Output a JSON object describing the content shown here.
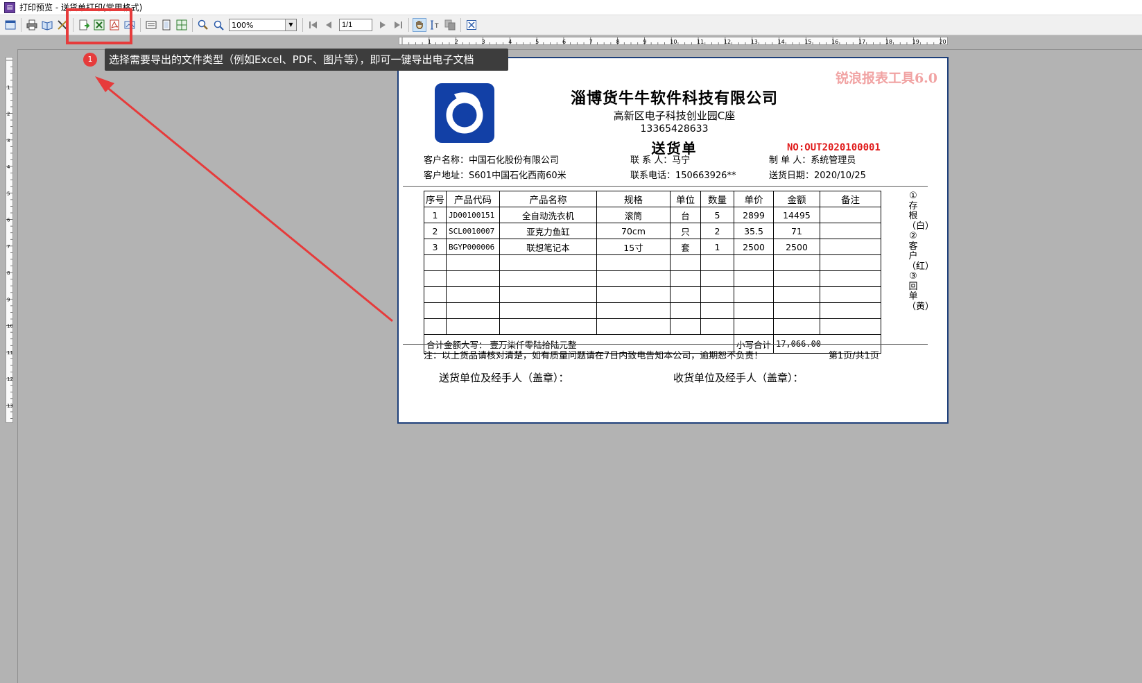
{
  "window": {
    "title": "打印预览 - 送货单打印(常用格式)"
  },
  "toolbar": {
    "zoom_value": "100%",
    "page_value": "1/1"
  },
  "tooltip": {
    "badge": "1",
    "text": "选择需要导出的文件类型（例如Excel、PDF、图片等），即可一键导出电子文档"
  },
  "colors": {
    "highlight": "#e63b3b",
    "doc_no": "#e01b1b",
    "watermark": "#f1a3a3",
    "logo_blue": "#1240a6"
  },
  "ruler": {
    "h_labels": [
      "1",
      "2",
      "3",
      "4",
      "5",
      "6",
      "7",
      "8",
      "9",
      "10",
      "11",
      "12",
      "13",
      "14",
      "15",
      "16",
      "17",
      "18",
      "19",
      "20"
    ],
    "v_labels": [
      "1",
      "2",
      "3",
      "4",
      "5",
      "6",
      "7",
      "8",
      "9",
      "10",
      "11",
      "12",
      "13"
    ]
  },
  "document": {
    "watermark": "锐浪报表工具6.0",
    "company": "淄博货牛牛软件科技有限公司",
    "address": "高新区电子科技创业园C座",
    "phone": "13365428633",
    "title": "送货单",
    "no": "NO:OUT2020100001",
    "info": {
      "customer_name": "客户名称：中国石化股份有限公司",
      "contact": "联 系 人：马宁",
      "maker": "制 单 人：系统管理员",
      "customer_addr": "客户地址：S601中国石化西南60米",
      "tel": "联系电话：150663926**",
      "date": "送货日期：2020/10/25"
    },
    "headers": [
      "序号",
      "产品代码",
      "产品名称",
      "规格",
      "单位",
      "数量",
      "单价",
      "金额",
      "备注"
    ],
    "rows": [
      [
        "1",
        "JD00100151",
        "全自动洗衣机",
        "滚筒",
        "台",
        "5",
        "2899",
        "14495",
        ""
      ],
      [
        "2",
        "SCL0010007",
        "亚克力鱼缸",
        "70cm",
        "只",
        "2",
        "35.5",
        "71",
        ""
      ],
      [
        "3",
        "BGYP000006",
        "联想笔记本",
        "15寸",
        "套",
        "1",
        "2500",
        "2500",
        ""
      ]
    ],
    "total_label": "合计金额大写：",
    "total_text": "壹万柒仟零陆拾陆元整",
    "subtotal_label": "小写合计",
    "subtotal_value": "17,066.00",
    "side_text": "①存根（白）②客户（红）③回单（黄）",
    "note": "注：以上货品请核对清楚，如有质量问题请在7日内致电告知本公司，逾期恕不负责！",
    "page_info": "第1页/共1页",
    "sign_sender": "送货单位及经手人（盖章）：",
    "sign_receiver": "收货单位及经手人（盖章）："
  }
}
